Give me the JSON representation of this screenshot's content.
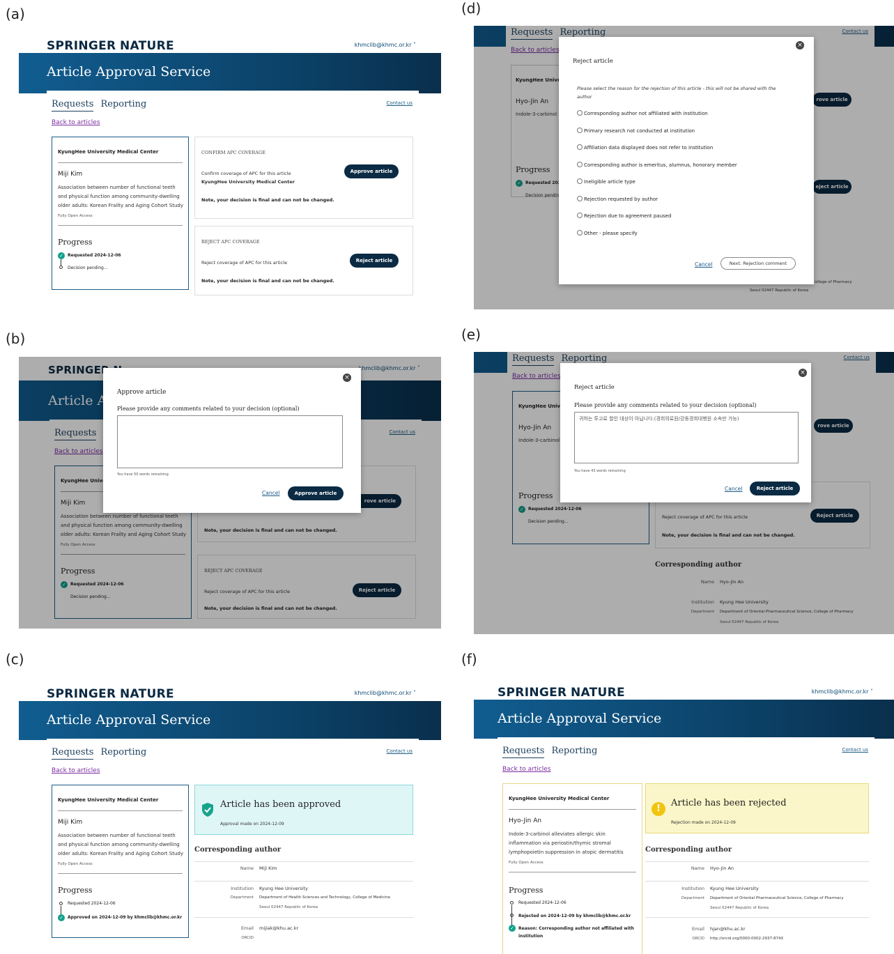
{
  "labels": {
    "a": "(a)",
    "b": "(b)",
    "c": "(c)",
    "d": "(d)",
    "e": "(e)",
    "f": "(f)"
  },
  "brand": {
    "springer": "SPRINGER",
    "nature": "NATURE",
    "email": "khmclib@khmc.or.kr  ˅",
    "service_title": "Article Approval Service"
  },
  "tabs": {
    "requests": "Requests",
    "reporting": "Reporting",
    "contact": "Contact us",
    "back": "Back to articles"
  },
  "article_a": {
    "institution": "KyungHee University Medical Center",
    "author": "Miji Kim",
    "title": "Association between number of functional teeth and physical function among community-dwelling older adults: Korean Frailty and Aging Cohort Study",
    "oa": "Fully Open Access"
  },
  "article_f": {
    "institution": "KyungHee University Medical Center",
    "author": "Hyo-Jin An",
    "title": "Indole-3-carbinol alleviates allergic skin inflammation via periostin/thymic stromal lymphopoietin suppression in atopic dermatitis",
    "oa": "Fully Open Access"
  },
  "progress": {
    "title": "Progress",
    "requested": "Requested 2024-12-06",
    "pending": "Decision pending...",
    "approved": "Approved on 2024-12-09 by khmclib@khmc.or.kr",
    "rejected": "Rejected on 2024-12-09 by khmclib@khmc.or.kr",
    "reason": "Reason: Corresponding author not affiliated with institution"
  },
  "confirm": {
    "heading": "CONFIRM APC COVERAGE",
    "line1": "Confirm coverage of APC for this article",
    "line2": "KyungHee University Medical Center",
    "note": "Note, your decision is final and can not be changed.",
    "button": "Approve article"
  },
  "reject": {
    "heading": "REJECT APC COVERAGE",
    "line1": "Reject coverage of APC for this article",
    "note": "Note, your decision is final and can not be changed.",
    "button": "Reject article"
  },
  "approve_modal": {
    "title": "Approve article",
    "prompt": "Please provide any comments related to your decision (optional)",
    "remaining": "You have 50 words remaining",
    "cancel": "Cancel",
    "button": "Approve article"
  },
  "reject_modal": {
    "title": "Reject article",
    "instruction": "Please select the reason for the rejection of this article - this will not be shared with the author",
    "options": [
      "Corresponding author not affiliated with institution",
      "Primary research not conducted at institution",
      "Affiliation data displayed does not refer to institution",
      "Corresponding author is emeritus, alumnus, honorary member",
      "Ineligible article type",
      "Rejection requested by author",
      "Rejection due to agreement paused",
      "Other - please specify"
    ],
    "cancel": "Cancel",
    "next": "Next: Rejection comment"
  },
  "reject_comment_modal": {
    "title": "Reject article",
    "prompt": "Please provide any comments related to your decision (optional)",
    "comment": "귀하는 투고료 할인 대상이 아닙니다.(경희의료원/강동경희대병원 소속만 가능)",
    "remaining": "You have 43 words remaining",
    "cancel": "Cancel",
    "button": "Reject article"
  },
  "approved_status": {
    "title": "Article has been approved",
    "date": "Approval made on 2024-12-09"
  },
  "rejected_status": {
    "title": "Article has been rejected",
    "date": "Rejection made on 2024-12-09"
  },
  "corr_c": {
    "heading": "Corresponding author",
    "name_label": "Name",
    "name": "Miji Kim",
    "inst_label": "Institution",
    "inst": "Kyung Hee University",
    "dept_label": "Department",
    "dept": "Department of Health Sciences and Technology, College of Medicine",
    "addr": "Seoul 02447 Republic of Korea",
    "email_label": "Email",
    "email": "mijiak@khu.ac.kr",
    "orcid_label": "ORCID"
  },
  "corr_f": {
    "heading": "Corresponding author",
    "name_label": "Name",
    "name": "Hyo-Jin An",
    "inst_label": "Institution",
    "inst": "Kyung Hee University",
    "dept_label": "Department",
    "dept": "Department of Oriental Pharmaceutical Science, College of Pharmacy",
    "addr": "Seoul 02447 Republic of Korea",
    "email_label": "Email",
    "email": "hjan@khu.ac.kr",
    "orcid_label": "ORCID",
    "orcid": "http://orcid.org/0000-0002-2937-874X"
  },
  "bg_partial": {
    "author": "Hyo-Jin An",
    "inst": "KyungHee Univer",
    "approve_trunc": "rove article",
    "reject_trunc": "eject article",
    "req_trunc": "Requested 202",
    "pending_trunc": "Decision pendin",
    "article_trunc": "Indole-3-carbinol",
    "addr": "Seoul 02447 Republic of Korea",
    "pharm": "College of Pharmacy",
    "brand_trunc": "SPRINGER N",
    "title_trunc": "Article Ap",
    "email_trunc": "khmclib@khmc.or.kr  ˅"
  }
}
